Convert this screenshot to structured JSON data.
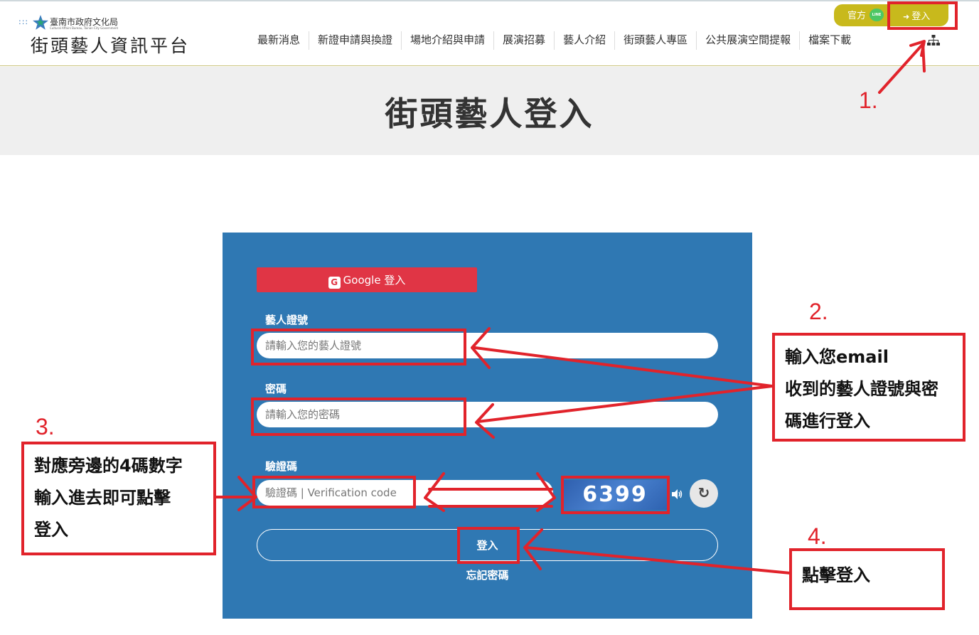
{
  "header": {
    "agency_name": "臺南市政府文化局",
    "agency_name_en": "Cultural Affairs Bureau, Tainan City Government",
    "site_title": "街頭藝人資訊平台",
    "official_label": "官方",
    "line_badge": "LINE",
    "login_label": "登入",
    "nav": [
      "最新消息",
      "新證申請與換證",
      "場地介紹與申請",
      "展演招募",
      "藝人介紹",
      "街頭藝人專區",
      "公共展演空間提報",
      "檔案下載"
    ]
  },
  "banner": {
    "title": "街頭藝人登入"
  },
  "form": {
    "google_label": "Google 登入",
    "google_icon": "G",
    "license_label": "藝人證號",
    "license_placeholder": "請輸入您的藝人證號",
    "password_label": "密碼",
    "password_placeholder": "請輸入您的密碼",
    "captcha_label": "驗證碼",
    "captcha_placeholder": "驗證碼 | Verification code",
    "captcha_value": "6399",
    "submit_label": "登入",
    "forgot_label": "忘記密碼"
  },
  "annotations": {
    "steps": [
      "1.",
      "2.",
      "3.",
      "4."
    ],
    "note2_lines": [
      "輸入您email",
      "收到的藝人證號與密",
      "碼進行登入"
    ],
    "note3_lines": [
      "對應旁邊的4碼數字",
      "輸入進去即可點擊",
      "登入"
    ],
    "note4_lines": [
      "點擊登入"
    ],
    "color": "#e1232b"
  },
  "colors": {
    "accent": "#c8b91c",
    "panel": "#2f78b3",
    "google": "#e03545",
    "banner": "#efefef"
  }
}
